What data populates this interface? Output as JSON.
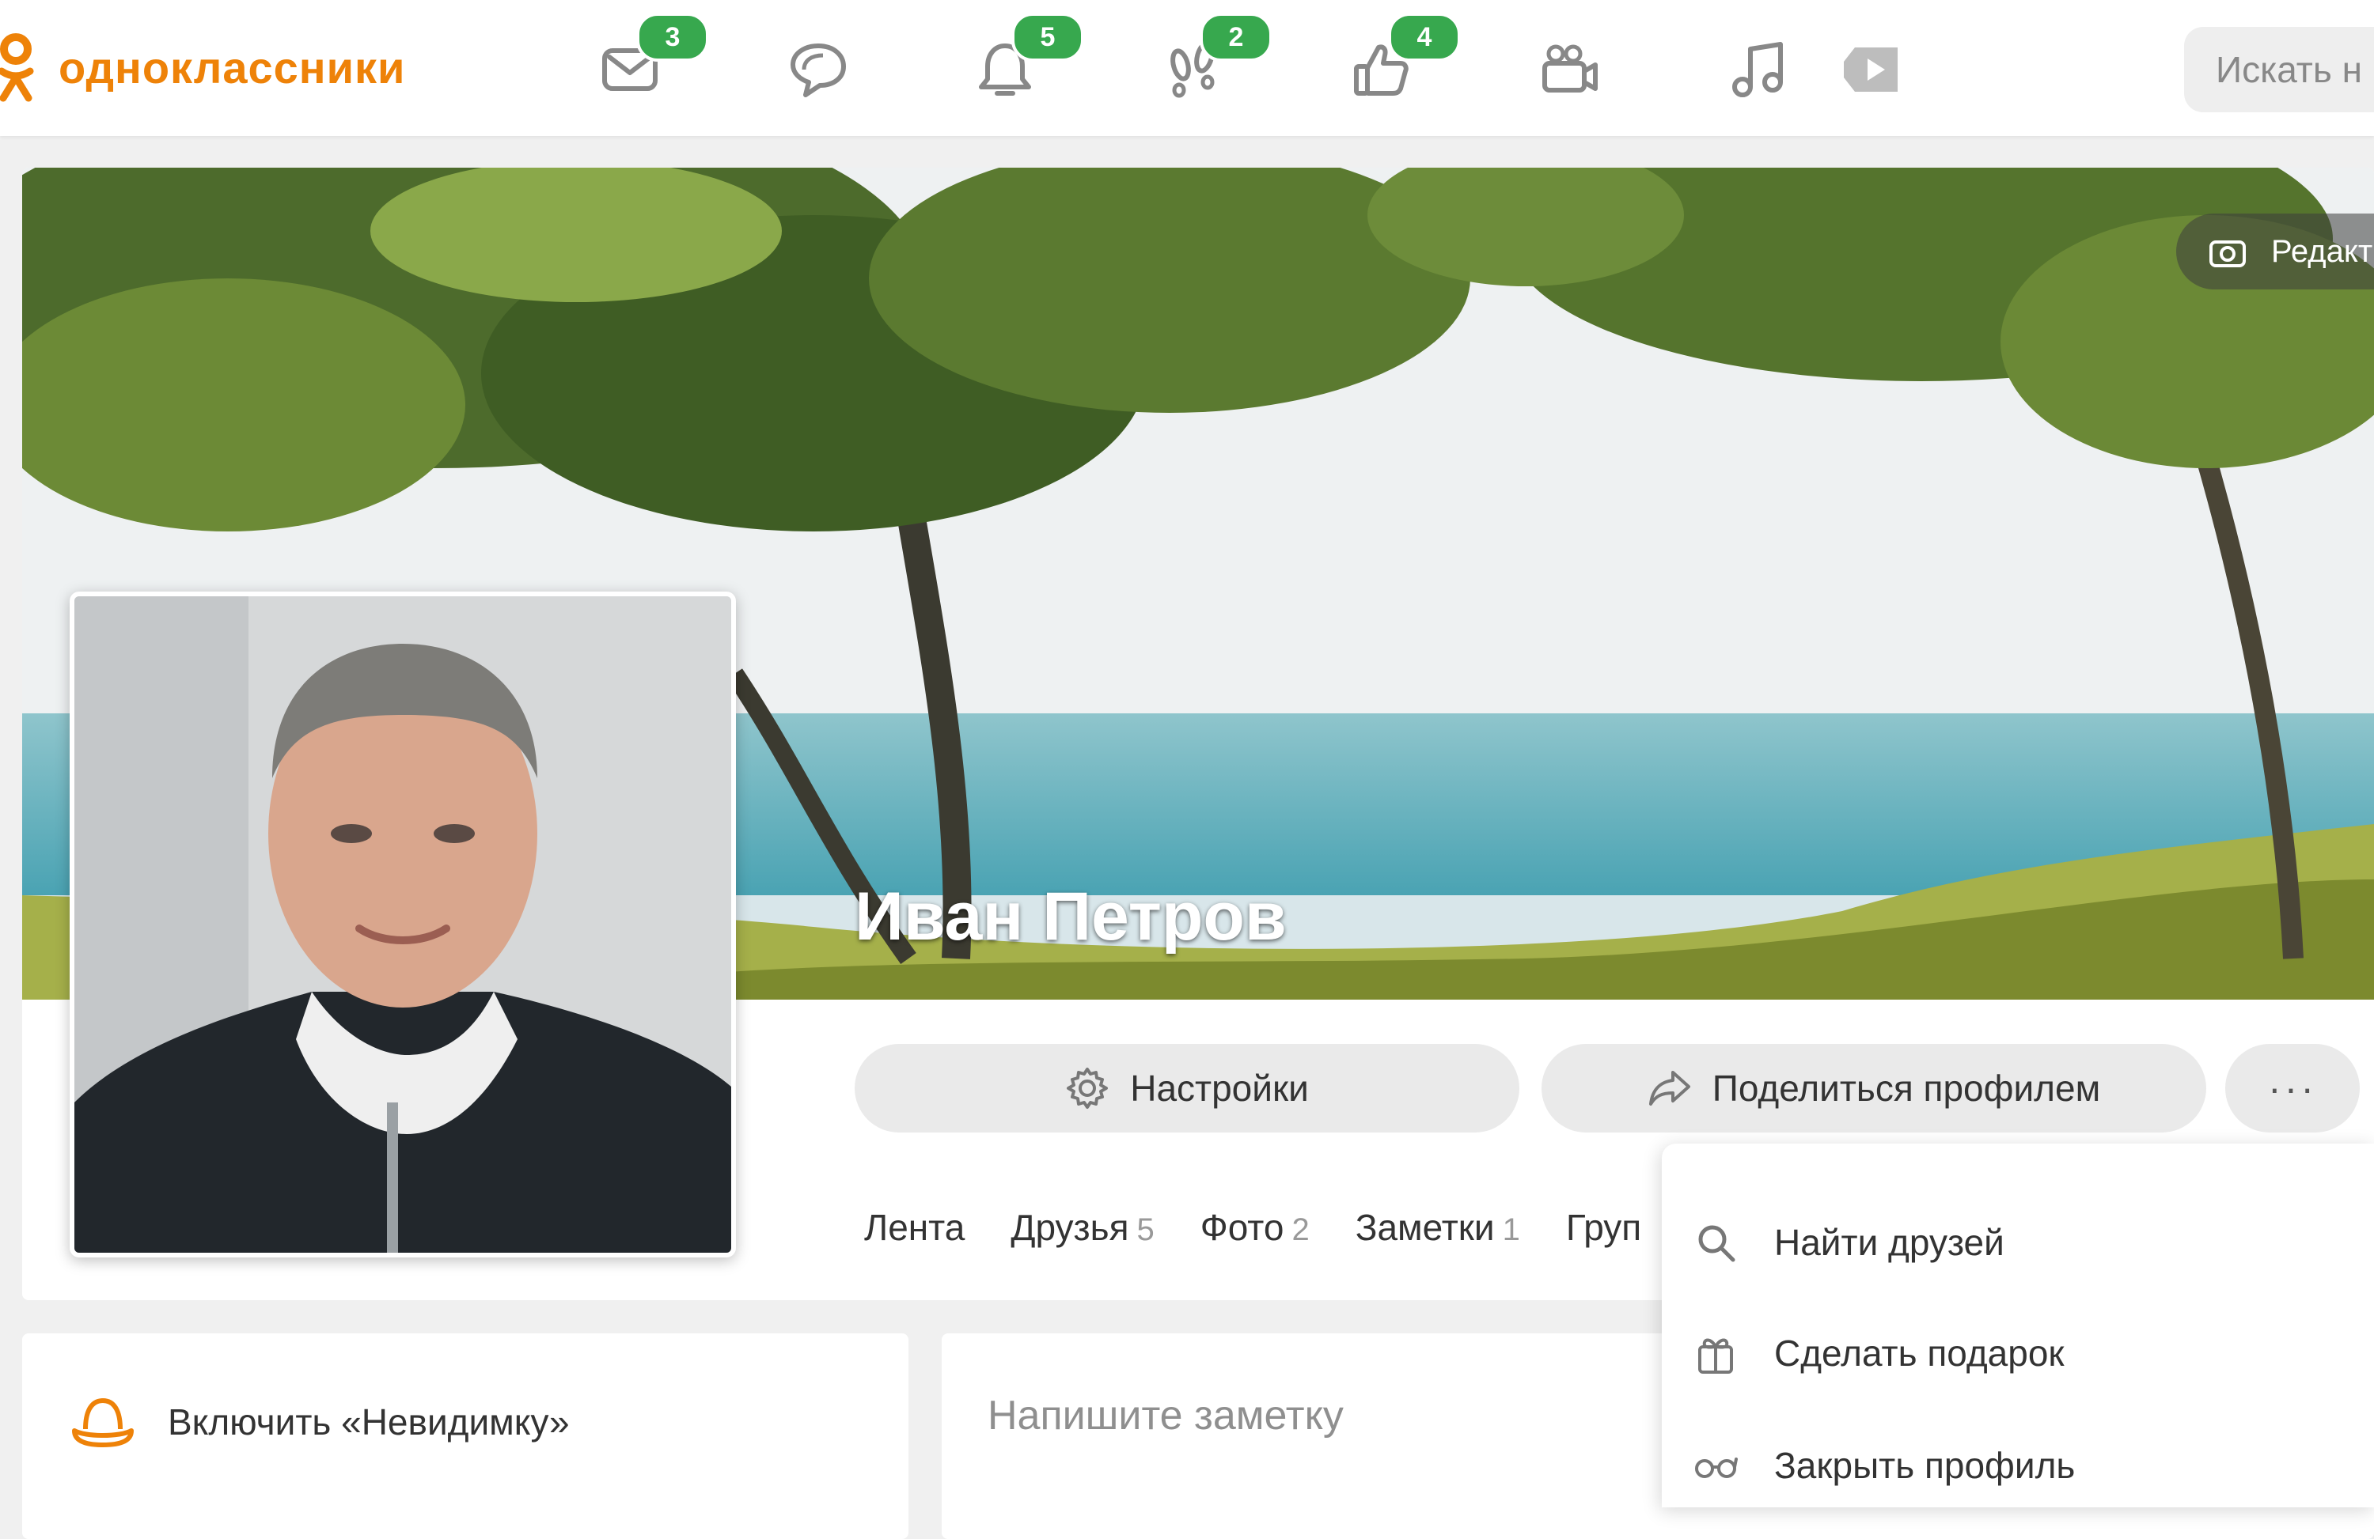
{
  "header": {
    "logo_text": "одноклассники",
    "nav": [
      {
        "icon": "mail-icon",
        "badge": "3"
      },
      {
        "icon": "chat-icon",
        "badge": ""
      },
      {
        "icon": "bell-icon",
        "badge": "5"
      },
      {
        "icon": "footprints-icon",
        "badge": "2"
      },
      {
        "icon": "thumbs-up-icon",
        "badge": "4"
      },
      {
        "icon": "video-camera-icon",
        "badge": ""
      },
      {
        "icon": "music-note-icon",
        "badge": ""
      },
      {
        "icon": "play-icon",
        "badge": ""
      }
    ],
    "search_placeholder": "Искать н"
  },
  "profile": {
    "name": "Иван Петров",
    "edit_cover_label": "Редакт",
    "settings_label": "Настройки",
    "share_label": "Поделиться профилем",
    "more_label": "···",
    "tabs": [
      {
        "label": "Лента",
        "count": ""
      },
      {
        "label": "Друзья",
        "count": "5"
      },
      {
        "label": "Фото",
        "count": "2"
      },
      {
        "label": "Заметки",
        "count": "1"
      },
      {
        "label": "Груп",
        "count": ""
      }
    ]
  },
  "dropdown": {
    "items": [
      {
        "label": "Найти друзей",
        "icon": "search-icon"
      },
      {
        "label": "Сделать подарок",
        "icon": "gift-icon"
      },
      {
        "label": "Закрыть профиль",
        "icon": "glasses-icon"
      }
    ]
  },
  "sidebar": {
    "invisible_label": "Включить «Невидимку»"
  },
  "feed": {
    "note_placeholder": "Напишите заметку"
  },
  "colors": {
    "brand": "#ee8208",
    "badge": "#37a84e",
    "button_bg": "#eaeaea"
  }
}
